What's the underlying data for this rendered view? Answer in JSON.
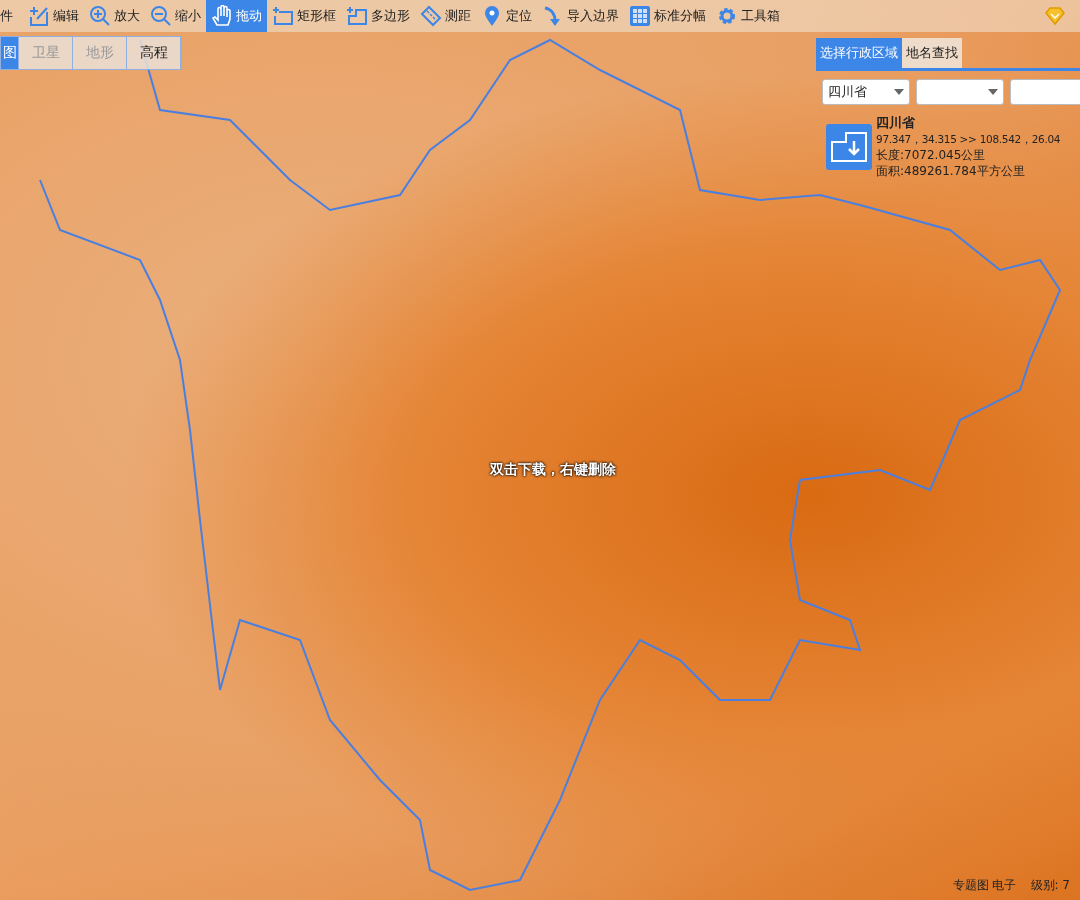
{
  "toolbar": [
    {
      "label": "件",
      "kind": "text",
      "selected": false
    },
    {
      "label": "编辑",
      "kind": "edit",
      "selected": false
    },
    {
      "label": "放大",
      "kind": "zoomin",
      "selected": false
    },
    {
      "label": "缩小",
      "kind": "zoomout",
      "selected": false
    },
    {
      "label": "拖动",
      "kind": "hand",
      "selected": true
    },
    {
      "label": "矩形框",
      "kind": "rect",
      "selected": false
    },
    {
      "label": "多边形",
      "kind": "polygon",
      "selected": false
    },
    {
      "label": "测距",
      "kind": "ruler",
      "selected": false
    },
    {
      "label": "定位",
      "kind": "pin",
      "selected": false
    },
    {
      "label": "导入边界",
      "kind": "import",
      "selected": false
    },
    {
      "label": "标准分幅",
      "kind": "grid",
      "selected": false
    },
    {
      "label": "工具箱",
      "kind": "gear",
      "selected": false
    }
  ],
  "map_types": [
    {
      "label": "图",
      "selected": true,
      "disabled": false
    },
    {
      "label": "卫星",
      "selected": false,
      "disabled": true
    },
    {
      "label": "地形",
      "selected": false,
      "disabled": true
    },
    {
      "label": "高程",
      "selected": false,
      "disabled": false
    }
  ],
  "map_hint": "双击下载，右键删除",
  "region_panel": {
    "tabs": [
      {
        "label": "选择行政区域",
        "selected": true
      },
      {
        "label": "地名查找",
        "selected": false
      }
    ],
    "selects": [
      {
        "kind": "dropdown",
        "value": "四川省"
      },
      {
        "kind": "dropdown"
      },
      {
        "kind": "cut"
      }
    ],
    "result": {
      "name": "四川省",
      "coords": "97.347，34.315 >> 108.542，26.04",
      "length": "长度:7072.045公里",
      "area": "面积:489261.784平方公里"
    }
  },
  "status_bar": {
    "layer": "专题图 电子",
    "zoom_level": "级别: 7"
  }
}
